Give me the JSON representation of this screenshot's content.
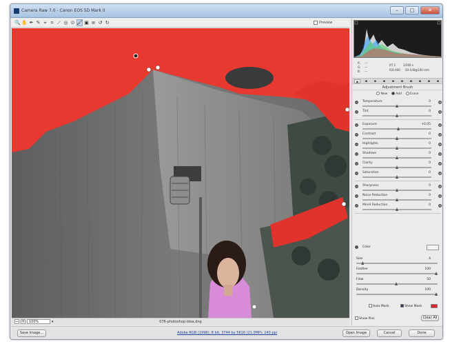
{
  "window": {
    "title": "Camera Raw 7.0 - Canon EOS 5D Mark II",
    "buttons": [
      "–",
      "□",
      "✕"
    ]
  },
  "toolbar": {
    "tools": [
      {
        "name": "zoom-tool",
        "glyph": "🔍",
        "active": false
      },
      {
        "name": "hand-tool",
        "glyph": "✋",
        "active": false
      },
      {
        "name": "white-balance-tool",
        "glyph": "✒",
        "active": false
      },
      {
        "name": "color-sampler-tool",
        "glyph": "✎",
        "active": false
      },
      {
        "name": "targeted-adjustment-tool",
        "glyph": "⌖",
        "active": false
      },
      {
        "name": "crop-tool",
        "glyph": "⌗",
        "active": false
      },
      {
        "name": "straighten-tool",
        "glyph": "⟋",
        "active": false
      },
      {
        "name": "spot-removal-tool",
        "glyph": "◎",
        "active": false
      },
      {
        "name": "red-eye-tool",
        "glyph": "⊙",
        "active": false
      },
      {
        "name": "adjustment-brush-tool",
        "glyph": "🖌",
        "active": true
      },
      {
        "name": "graduated-filter-tool",
        "glyph": "▣",
        "active": false
      },
      {
        "name": "preferences-tool",
        "glyph": "≡",
        "active": false
      },
      {
        "name": "rotate-ccw-tool",
        "glyph": "↺",
        "active": false
      },
      {
        "name": "rotate-cw-tool",
        "glyph": "↻",
        "active": false
      }
    ],
    "preview_label": "Preview"
  },
  "status": {
    "zoom_value": "100%",
    "filename": "076-photoshop-idea.dng"
  },
  "info": {
    "r_label": "R:",
    "r_value": "---",
    "g_label": "G:",
    "g_value": "---",
    "b_label": "B:",
    "b_value": "---",
    "aperture": "f/7.1",
    "shutter": "1/200 s",
    "iso": "ISO 400",
    "focal": "50-100@100 mm"
  },
  "panel": {
    "title": "Adjustment Brush",
    "modes": [
      "New",
      "Add",
      "Erase"
    ],
    "active_mode": "Add",
    "sliders_group1": [
      {
        "label": "Temperature",
        "value": "0",
        "pos": 0.5
      },
      {
        "label": "Tint",
        "value": "0",
        "pos": 0.5
      }
    ],
    "sliders_group2": [
      {
        "label": "Exposure",
        "value": "+0.05",
        "pos": 0.52
      },
      {
        "label": "Contrast",
        "value": "0",
        "pos": 0.5
      },
      {
        "label": "Highlights",
        "value": "0",
        "pos": 0.5
      },
      {
        "label": "Shadows",
        "value": "0",
        "pos": 0.5
      },
      {
        "label": "Clarity",
        "value": "0",
        "pos": 0.5
      },
      {
        "label": "Saturation",
        "value": "0",
        "pos": 0.5
      }
    ],
    "sliders_group3": [
      {
        "label": "Sharpness",
        "value": "0",
        "pos": 0.5
      },
      {
        "label": "Noise Reduction",
        "value": "0",
        "pos": 0.5
      },
      {
        "label": "Moiré Reduction",
        "value": "0",
        "pos": 0.5
      }
    ],
    "color_label": "Color",
    "brush": [
      {
        "label": "Size",
        "value": "4",
        "pos": 0.08
      },
      {
        "label": "Feather",
        "value": "100",
        "pos": 1.0
      },
      {
        "label": "Flow",
        "value": "50",
        "pos": 0.5
      },
      {
        "label": "Density",
        "value": "100",
        "pos": 1.0
      }
    ],
    "auto_mask_label": "Auto Mask",
    "show_mask_label": "Show Mask",
    "show_pins_label": "Show Pins",
    "clear_all_label": "Clear All",
    "mask_color": "#d8262e"
  },
  "bottom": {
    "save_label": "Save Image...",
    "workflow_link": "Adobe RGB (1998); 8 bit; 3744 by 5616 (21.0MP); 240 ppi",
    "open_label": "Open Image",
    "cancel_label": "Cancel",
    "done_label": "Done"
  }
}
